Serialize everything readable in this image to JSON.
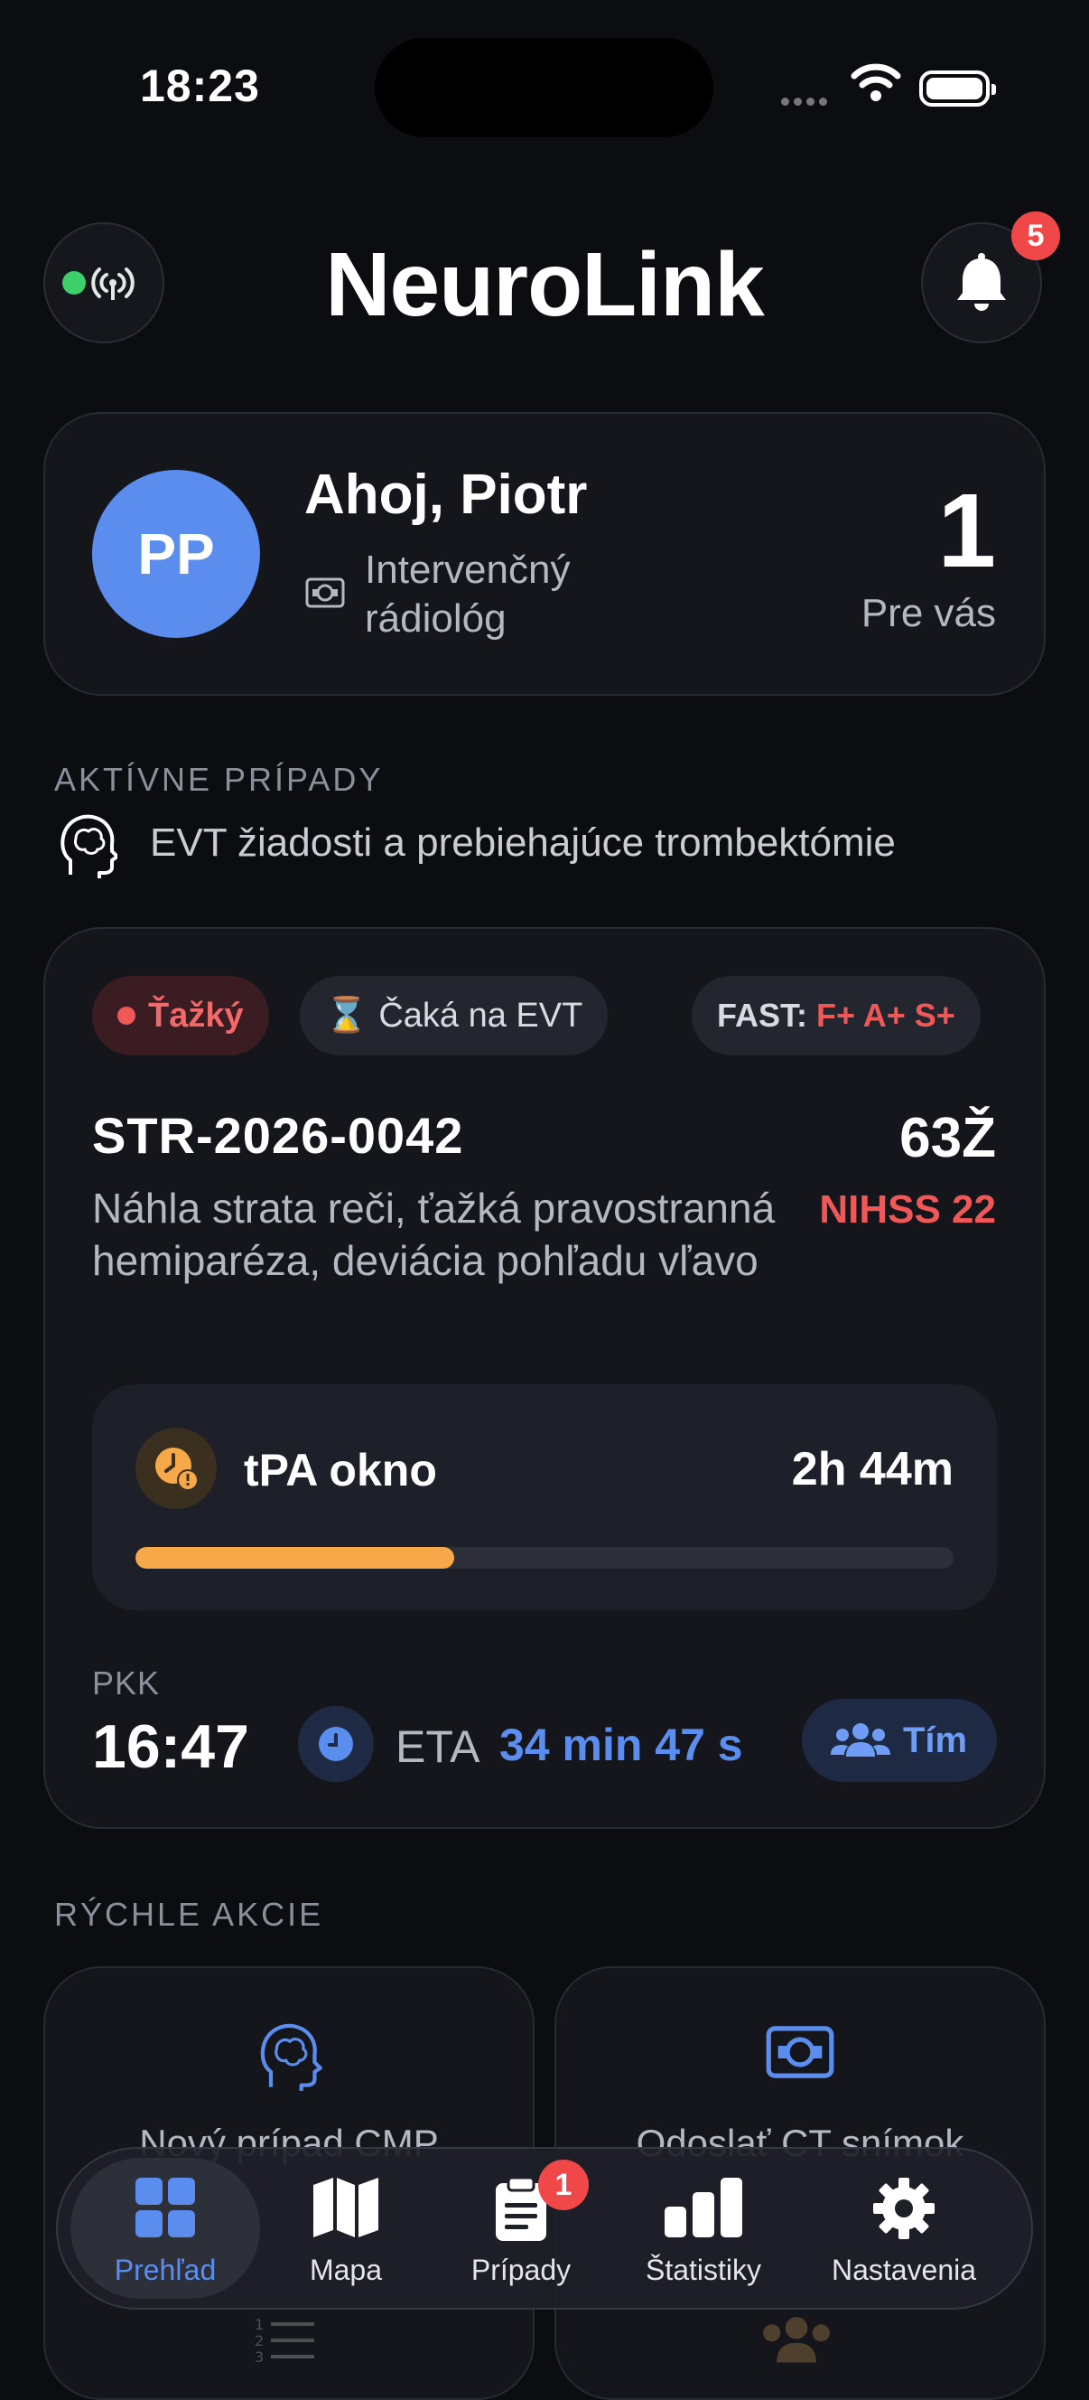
{
  "status_bar": {
    "time": "18:23"
  },
  "header": {
    "title": "NeuroLink",
    "notifications_count": "5"
  },
  "profile": {
    "initials": "PP",
    "greeting": "Ahoj, Piotr",
    "role": "Intervenčný rádiológ",
    "count": "1",
    "count_label": "Pre vás"
  },
  "active_cases": {
    "label": "AKTÍVNE PRÍPADY",
    "subtitle": "EVT žiadosti a prebiehajúce trombektómie"
  },
  "case": {
    "severity": "Ťažký",
    "status": "Čaká na EVT",
    "fast_label": "FAST:",
    "fast_values": "F+ A+ S+",
    "id": "STR-2026-0042",
    "age": "63Ž",
    "nihss": "NIHSS 22",
    "description": "Náhla strata reči, ťažká pravostranná hemiparéza, deviácia pohľadu vľavo",
    "tpa_label": "tPA okno",
    "tpa_remaining": "2h 44m",
    "tpa_progress": 0.39,
    "pkk_label": "PKK",
    "pkk_time": "16:47",
    "eta_label": "ETA",
    "eta_value": "34 min 47 s",
    "team_label": "Tím"
  },
  "quick_actions": {
    "label": "RÝCHLE AKCIE",
    "items": [
      {
        "label": "Nový prípad CMP",
        "icon": "brain-head-icon"
      },
      {
        "label": "Odoslať CT snímok",
        "icon": "ct-scan-icon"
      }
    ]
  },
  "tab_bar": {
    "items": [
      {
        "label": "Prehľad",
        "icon": "grid-icon",
        "active": true
      },
      {
        "label": "Mapa",
        "icon": "map-icon"
      },
      {
        "label": "Prípady",
        "icon": "clipboard-icon",
        "badge": "1"
      },
      {
        "label": "Štatistiky",
        "icon": "bar-chart-icon"
      },
      {
        "label": "Nastavenia",
        "icon": "gear-icon"
      }
    ]
  },
  "colors": {
    "accent": "#5b8def",
    "danger": "#f05858",
    "warning": "#f7a94a",
    "background": "#0c0d11"
  }
}
